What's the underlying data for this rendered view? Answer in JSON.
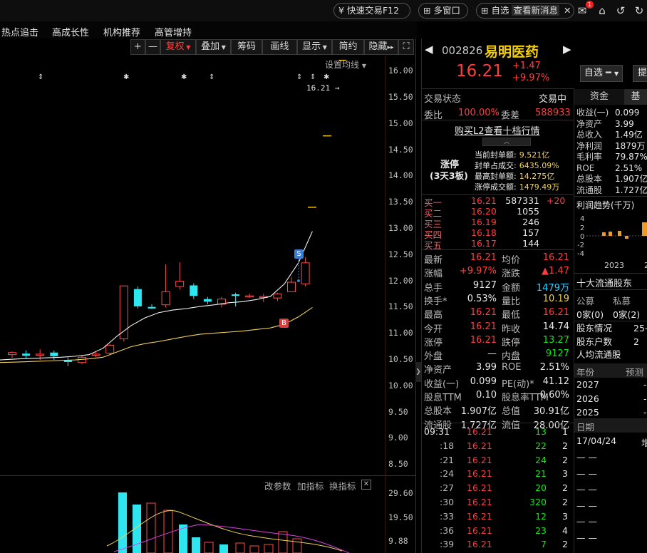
{
  "topbar": {
    "quick_trade": "快速交易F12",
    "multi_window": "多窗口",
    "self_label": "自选",
    "news_tab": "查看新消息",
    "mail_badge": "1"
  },
  "nav": {
    "items": [
      "热点追击",
      "高成长性",
      "机构推荐",
      "高管增持"
    ]
  },
  "chart_toolbar": {
    "buttons": [
      "+",
      "—",
      "复权",
      "叠加",
      "筹码",
      "画线",
      "显示",
      "简约",
      "隐藏"
    ],
    "ma_setting": "设置均线",
    "indicator_params": "改参数",
    "add_indicator": "加指标",
    "switch_indicator": "换指标"
  },
  "colors": {
    "up": "#ff3d3d",
    "down": "#14e614",
    "cyan": "#29d0ff",
    "yellow": "#f0d25a",
    "magenta": "#e040e0",
    "bg": "#000000"
  },
  "chart_data": {
    "type": "candlestick",
    "y_ticks": [
      "16.00",
      "15.50",
      "15.00",
      "14.50",
      "14.00",
      "13.50",
      "13.00",
      "12.50",
      "12.00",
      "11.50",
      "11.00",
      "10.50",
      "10.00",
      "9.50",
      "9.00",
      "8.50"
    ],
    "ylim": [
      8.3,
      16.3
    ],
    "last_price_tag": "16.21",
    "candles": [
      {
        "o": 10.6,
        "h": 10.66,
        "l": 10.54,
        "c": 10.64
      },
      {
        "o": 10.62,
        "h": 10.68,
        "l": 10.52,
        "c": 10.58
      },
      {
        "o": 10.6,
        "h": 10.7,
        "l": 10.5,
        "c": 10.61
      },
      {
        "o": 10.64,
        "h": 10.68,
        "l": 10.5,
        "c": 10.57
      },
      {
        "o": 10.5,
        "h": 10.55,
        "l": 10.38,
        "c": 10.46
      },
      {
        "o": 10.45,
        "h": 10.58,
        "l": 10.42,
        "c": 10.55
      },
      {
        "o": 10.6,
        "h": 10.65,
        "l": 10.55,
        "c": 10.61
      },
      {
        "o": 10.63,
        "h": 10.8,
        "l": 10.6,
        "c": 10.78
      },
      {
        "o": 10.9,
        "h": 11.92,
        "l": 10.85,
        "c": 11.91
      },
      {
        "o": 11.85,
        "h": 11.9,
        "l": 11.48,
        "c": 11.52
      },
      {
        "o": 11.51,
        "h": 11.56,
        "l": 11.47,
        "c": 11.48
      },
      {
        "o": 11.55,
        "h": 12.32,
        "l": 11.5,
        "c": 11.8
      },
      {
        "o": 11.9,
        "h": 12.36,
        "l": 11.84,
        "c": 12.0
      },
      {
        "o": 11.92,
        "h": 11.96,
        "l": 11.66,
        "c": 11.72
      },
      {
        "o": 11.66,
        "h": 11.7,
        "l": 11.56,
        "c": 11.61
      },
      {
        "o": 11.56,
        "h": 11.7,
        "l": 11.5,
        "c": 11.66
      },
      {
        "o": 11.75,
        "h": 11.78,
        "l": 11.52,
        "c": 11.72
      },
      {
        "o": 11.72,
        "h": 11.76,
        "l": 11.68,
        "c": 11.72
      },
      {
        "o": 11.7,
        "h": 11.76,
        "l": 11.6,
        "c": 11.71
      },
      {
        "o": 11.68,
        "h": 11.78,
        "l": 11.62,
        "c": 11.76
      },
      {
        "o": 11.8,
        "h": 12.08,
        "l": 11.8,
        "c": 11.98
      },
      {
        "o": 11.95,
        "h": 12.46,
        "l": 11.9,
        "c": 12.35
      }
    ],
    "ma_short": [
      10.5,
      10.52,
      10.53,
      10.54,
      10.55,
      10.57,
      10.6,
      10.72,
      10.95,
      11.15,
      11.3,
      11.4,
      11.45,
      11.48,
      11.52,
      11.55,
      11.59,
      11.61,
      11.65,
      11.71,
      11.95,
      12.35,
      12.95
    ],
    "ma_long": [
      10.45,
      10.46,
      10.47,
      10.48,
      10.49,
      10.5,
      10.52,
      10.55,
      10.65,
      10.75,
      10.81,
      10.85,
      10.9,
      10.95,
      10.99,
      11.01,
      11.03,
      11.05,
      11.08,
      11.11,
      11.18,
      11.32,
      11.5
    ],
    "volume": {
      "y_ticks": [
        "29.60",
        "19.50",
        "9.88"
      ],
      "ylim": [
        0,
        30
      ]
    }
  },
  "stock": {
    "code": "002826",
    "name": "易明医药",
    "price": "16.21",
    "change": "+1.47",
    "change_pct": "+9.97%",
    "watchlist_btn": "自选",
    "more_btn": "提"
  },
  "status": {
    "label": "交易状态",
    "value": "交易中",
    "ratio_label": "委比",
    "ratio_value": "100.00%",
    "diff_label": "委差",
    "diff_value": "588933",
    "l2_link": "购买L2查看十档行情"
  },
  "limit_up": {
    "title": "涨停",
    "sub": "(3天3板)",
    "rows": [
      {
        "k": "当前封单额:",
        "v": "9.521亿"
      },
      {
        "k": "封单占成交:",
        "v": "6435.09%"
      },
      {
        "k": "最高封单额:",
        "v": "14.275亿"
      },
      {
        "k": "涨停成交额:",
        "v": "1479.49万"
      }
    ]
  },
  "orderbook": [
    {
      "label": "买一",
      "price": "16.21",
      "vol": "587331",
      "chg": "+20"
    },
    {
      "label": "买二",
      "price": "16.20",
      "vol": "1055",
      "chg": ""
    },
    {
      "label": "买三",
      "price": "16.19",
      "vol": "246",
      "chg": ""
    },
    {
      "label": "买四",
      "price": "16.18",
      "vol": "157",
      "chg": ""
    },
    {
      "label": "买五",
      "price": "16.17",
      "vol": "144",
      "chg": ""
    }
  ],
  "quote": [
    {
      "k1": "最新",
      "v1": "16.21",
      "k2": "均价",
      "v2": "16.21"
    },
    {
      "k1": "涨幅",
      "v1": "+9.97%",
      "k2": "涨跌",
      "v2": "▲1.47"
    },
    {
      "k1": "总手",
      "v1": "9127",
      "k2": "金额",
      "v2": "1479万"
    },
    {
      "k1": "换手*",
      "v1": "0.53%",
      "k2": "量比",
      "v2": "10.19"
    },
    {
      "k1": "最高",
      "v1": "16.21",
      "k2": "最低",
      "v2": "16.21"
    },
    {
      "k1": "今开",
      "v1": "16.21",
      "k2": "昨收",
      "v2": "14.74"
    },
    {
      "k1": "涨停",
      "v1": "16.21",
      "k2": "跌停",
      "v2": "13.27"
    },
    {
      "k1": "外盘",
      "v1": "—",
      "k2": "内盘",
      "v2": "9127"
    },
    {
      "k1": "净资产",
      "v1": "3.99",
      "k2": "ROE",
      "v2": "2.51%"
    },
    {
      "k1": "收益(一)",
      "v1": "0.099",
      "k2": "PE(动)*",
      "v2": "41.12"
    },
    {
      "k1": "股息TTM",
      "v1": "0.10",
      "k2": "股息率TTM",
      "v2": "0.60%"
    },
    {
      "k1": "总股本",
      "v1": "1.907亿",
      "k2": "总值",
      "v2": "30.91亿"
    },
    {
      "k1": "流通股",
      "v1": "1.727亿",
      "k2": "流值",
      "v2": "28.00亿"
    }
  ],
  "ticks": [
    {
      "t": "09:31",
      "p": "16.21",
      "v": "13",
      "n": "1"
    },
    {
      "t": ":18",
      "p": "16.21",
      "v": "22",
      "n": "2"
    },
    {
      "t": ":21",
      "p": "16.21",
      "v": "24",
      "n": "2"
    },
    {
      "t": ":24",
      "p": "16.21",
      "v": "21",
      "n": "3"
    },
    {
      "t": ":27",
      "p": "16.21",
      "v": "20",
      "n": "2"
    },
    {
      "t": ":30",
      "p": "16.21",
      "v": "320",
      "n": "2"
    },
    {
      "t": ":33",
      "p": "16.21",
      "v": "12",
      "n": "3"
    },
    {
      "t": ":36",
      "p": "16.21",
      "v": "23",
      "n": "4"
    },
    {
      "t": ":39",
      "p": "16.21",
      "v": "7",
      "n": "2"
    }
  ],
  "right": {
    "tab_fund": "资金",
    "tab_basic": "基",
    "fin": [
      {
        "k": "收益(一)",
        "v": "0.099"
      },
      {
        "k": "净资产",
        "v": "3.99"
      },
      {
        "k": "总收入",
        "v": "1.49亿"
      },
      {
        "k": "净利润",
        "v": "1879万"
      },
      {
        "k": "毛利率",
        "v": "79.87%"
      },
      {
        "k": "ROE",
        "v": "2.51%"
      },
      {
        "k": "总股本",
        "v": "1.907亿"
      },
      {
        "k": "流通股",
        "v": "1.727亿"
      }
    ],
    "profit_title": "利润趋势(千万)",
    "profit_y": [
      "4",
      "2",
      "0",
      "-2",
      "-4"
    ],
    "profit_year": "2023",
    "profit_year2": "2",
    "holders_title": "十大流通股东",
    "fund_label": "公募",
    "private_label": "私募",
    "fund_val": "0家(0)",
    "private_val": "0家(2)",
    "holder_rows": [
      {
        "k": "股东情况",
        "v": "25-"
      },
      {
        "k": "股东户数",
        "v": "2"
      },
      {
        "k": "人均流通股",
        "v": ""
      }
    ],
    "year_label": "年份",
    "forecast_label": "预测",
    "years": [
      "2027",
      "2026",
      "2025"
    ],
    "date_label": "日期",
    "date_val": "17/04/24",
    "date_tail": "增",
    "dash_rows": [
      "— —",
      "— —",
      "— —",
      "— —",
      "— —",
      "— —"
    ]
  }
}
